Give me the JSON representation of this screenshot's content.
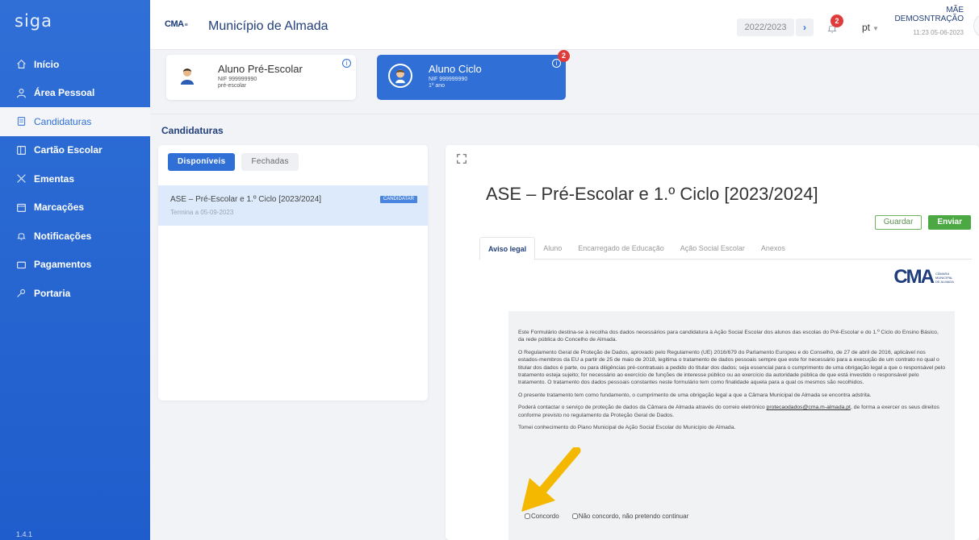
{
  "sidebar": {
    "logo": "siga",
    "items": [
      {
        "label": "Início",
        "icon": "home-icon"
      },
      {
        "label": "Área Pessoal",
        "icon": "user-icon"
      },
      {
        "label": "Candidaturas",
        "icon": "document-icon"
      },
      {
        "label": "Cartão Escolar",
        "icon": "card-icon"
      },
      {
        "label": "Ementas",
        "icon": "utensils-icon"
      },
      {
        "label": "Marcações",
        "icon": "calendar-icon"
      },
      {
        "label": "Notificações",
        "icon": "bell-icon"
      },
      {
        "label": "Pagamentos",
        "icon": "wallet-icon"
      },
      {
        "label": "Portaria",
        "icon": "key-icon"
      }
    ],
    "version": "1.4.1"
  },
  "header": {
    "brand": "CMA",
    "title": "Município de Almada",
    "year": "2022/2023",
    "notifications_count": "2",
    "language": "pt",
    "user_name": "MÃE DEMOSNTRAÇÃO",
    "timestamp": "11:23 05-06-2023"
  },
  "students": [
    {
      "name": "Aluno Pré-Escolar",
      "nif": "NIF 999999990",
      "level": "pré-escolar"
    },
    {
      "name": "Aluno Ciclo",
      "nif": "NIF 999999990",
      "level": "1º ano",
      "badge": "2"
    }
  ],
  "section_title": "Candidaturas",
  "left_panel": {
    "tabs": [
      "Disponíveis",
      "Fechadas"
    ],
    "items": [
      {
        "title": "ASE – Pré-Escolar e 1.º Ciclo [2023/2024]",
        "subtitle": "Termina a 05-09-2023",
        "badge": "CANDIDATAR"
      }
    ]
  },
  "form": {
    "title": "ASE – Pré-Escolar e 1.º Ciclo [2023/2024]",
    "save_label": "Guardar",
    "send_label": "Enviar",
    "tabs": [
      "Aviso legal",
      "Aluno",
      "Encarregado de Educação",
      "Ação Social Escolar",
      "Anexos"
    ],
    "logo_text": "CMA",
    "logo_sub": "CÂMARA MUNICIPAL DE ALMADA",
    "paragraphs": [
      "Este Formulário destina-se à recolha dos dados necessários para candidatura à Ação Social Escolar dos alunos das escolas do Pré-Escolar e do 1.º Ciclo do Ensino Básico, da rede pública do Concelho de Almada.",
      "O Regulamento Geral de Proteção de Dados, aprovado pelo Regulamento (UE) 2016/679 do Parlamento Europeu e do Conselho, de 27 de abril de 2016, aplicável nos estados-membros da EU a partir de 25 de maio de 2018, legitima o tratamento de dados pessoais sempre que este for necessário para a execução de um contrato no qual o titular dos dados é parte, ou para diligências pré-contratuais a pedido do titular dos dados; seja essencial para o cumprimento de uma obrigação legal a que o responsável pelo tratamento esteja sujeito; for necessário ao exercício de funções de interesse público ou ao exercício da autoridade pública de que está investido o responsável pelo tratamento. O tratamento dos dados pessoais constantes neste formulário tem como finalidade aquela para a qual os mesmos são recolhidos.",
      "O presente tratamento tem como fundamento, o cumprimento de uma obrigação legal a que a Câmara Municipal de Almada se encontra adstrita.",
      "Tomei conhecimento do Plano Municipal de Ação Social Escolar do Município de Almada."
    ],
    "contact_before": "Poderá contactar o serviço de proteção de dados da Câmara de Almada através do correio eletrónico ",
    "contact_email": "protecaodados@cma.m-almada.pt",
    "contact_after": ", de forma a exercer os seus direitos conforme previsto no regulamento da Proteção Geral de Dados.",
    "agree_label": "Concordo",
    "disagree_label": "Não concordo, não pretendo continuar"
  },
  "colors": {
    "primary": "#2f6fd6",
    "accent_arrow": "#f5b800",
    "success": "#4ba843",
    "danger": "#e03b3b"
  }
}
